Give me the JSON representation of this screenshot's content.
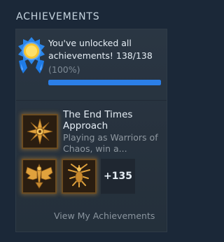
{
  "section": {
    "title": "ACHIEVEMENTS"
  },
  "summary": {
    "unlock_message": "You've unlocked all achievements! 138/138",
    "percent_label": "(100%)",
    "progress_fraction": 1.0,
    "badge_icon": "blue-gold-medal-icon"
  },
  "featured": {
    "title": "The End Times Approach",
    "description": "Playing as Warriors of Chaos, win a...",
    "icon": "chaos-star-achievement-icon"
  },
  "recent": [
    {
      "icon": "winged-eagle-achievement-icon"
    },
    {
      "icon": "spider-sigil-achievement-icon"
    }
  ],
  "more": {
    "count_label": "+135"
  },
  "footer": {
    "link_label": "View My Achievements"
  },
  "colors": {
    "background": "#1b2838",
    "progress_fill": "#2b7fe8",
    "icon_glow": "#dc9632"
  }
}
